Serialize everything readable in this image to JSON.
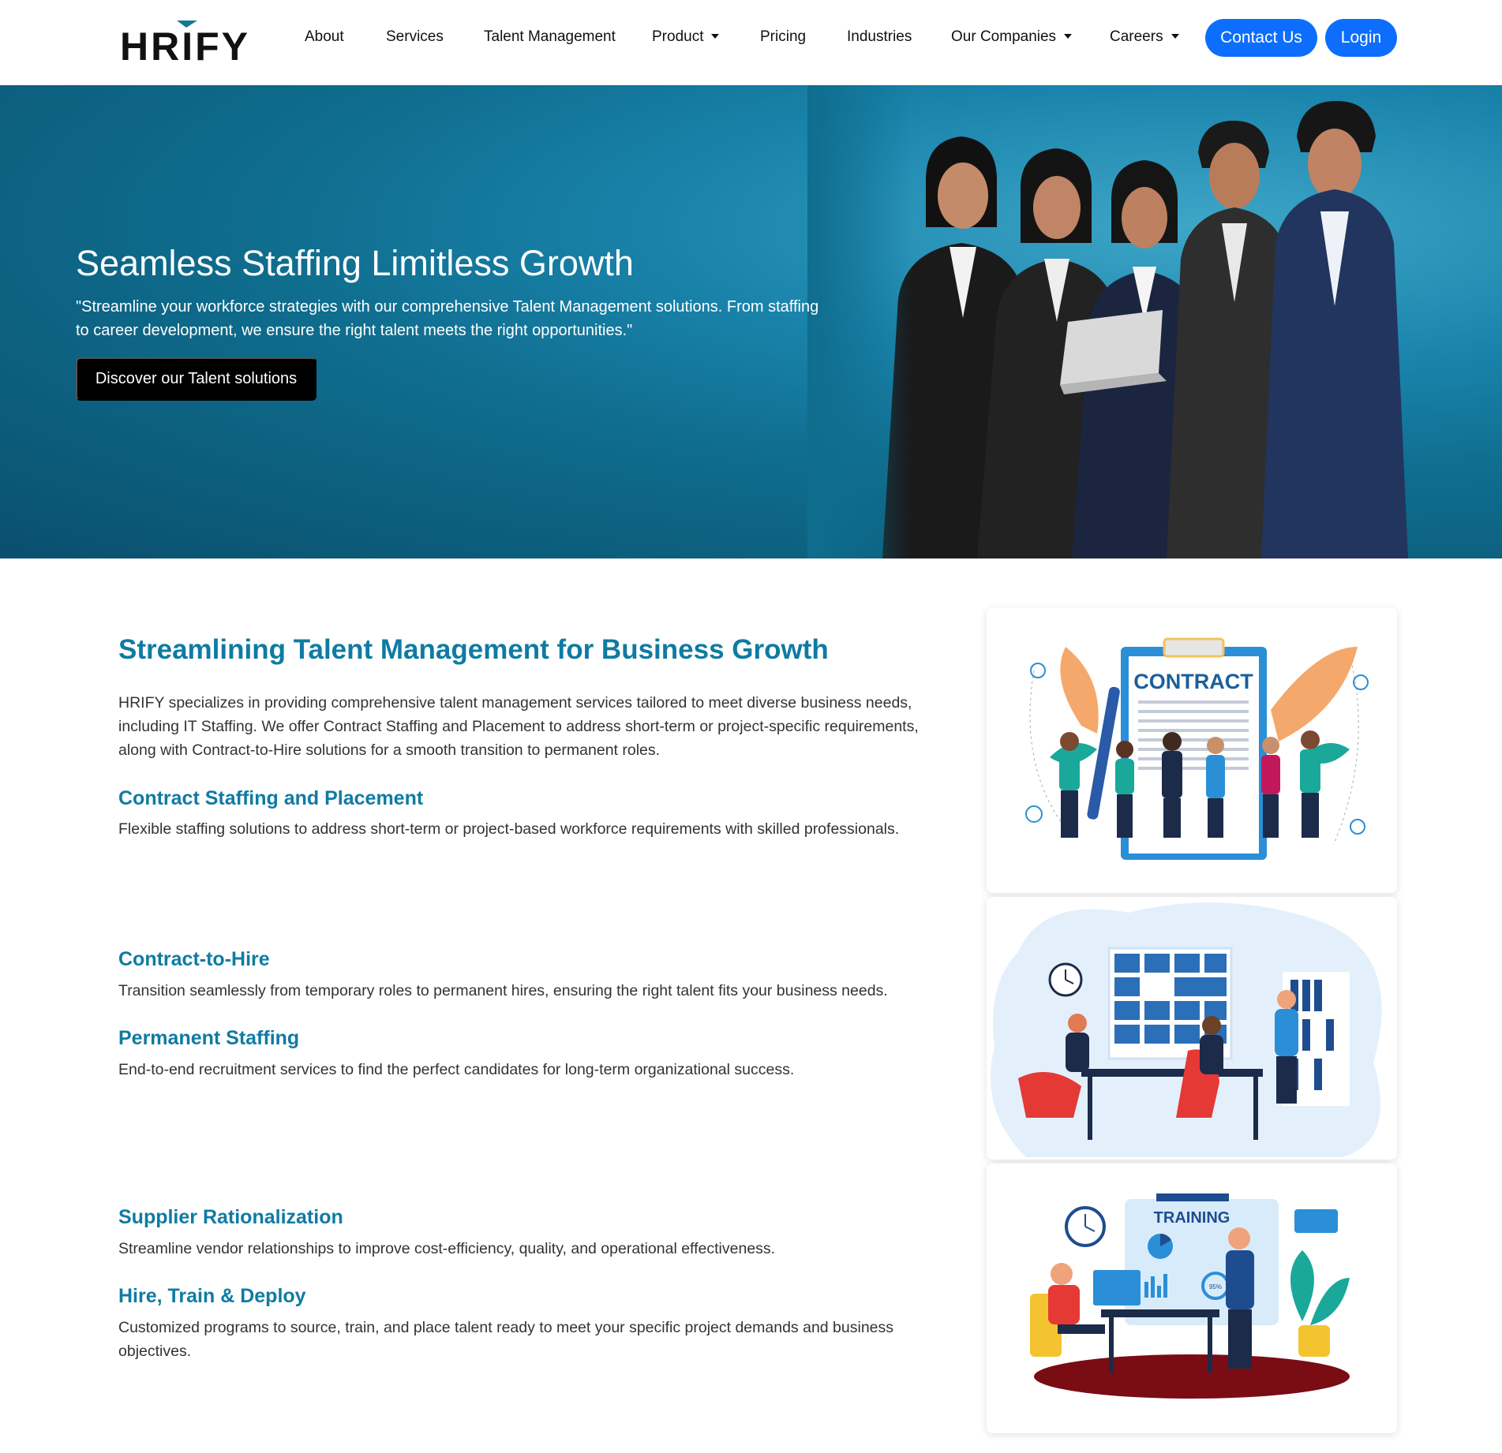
{
  "brand": {
    "logo_text": "HRIFY"
  },
  "nav": {
    "about": "About",
    "services": "Services",
    "talent_management": "Talent Management",
    "product": "Product",
    "pricing": "Pricing",
    "industries": "Industries",
    "our_companies": "Our Companies",
    "careers": "Careers",
    "contact": "Contact Us",
    "login": "Login"
  },
  "hero": {
    "title": "Seamless Staffing Limitless Growth",
    "text": "\"Streamline your workforce strategies with our comprehensive Talent Management solutions. From staffing to career development, we ensure the right talent meets the right opportunities.\"",
    "button": "Discover our Talent solutions"
  },
  "main": {
    "title": "Streamlining Talent Management for Business Growth",
    "intro": "HRIFY specializes in providing comprehensive talent management services tailored to meet diverse business needs, including IT Staffing. We offer Contract Staffing and Placement to address short-term or project-specific requirements, along with Contract-to-Hire solutions for a smooth transition to permanent roles.",
    "services": [
      {
        "title": "Contract Staffing and Placement",
        "desc": "Flexible staffing solutions to address short-term or project-based workforce requirements with skilled professionals."
      },
      {
        "title": "Contract-to-Hire",
        "desc": "Transition seamlessly from temporary roles to permanent hires, ensuring the right talent fits your business needs."
      },
      {
        "title": "Permanent Staffing",
        "desc": "End-to-end recruitment services to find the perfect candidates for long-term organizational success."
      },
      {
        "title": "Supplier Rationalization",
        "desc": "Streamline vendor relationships to improve cost-efficiency, quality, and operational effectiveness."
      },
      {
        "title": "Hire, Train & Deploy",
        "desc": "Customized programs to source, train, and place talent ready to meet your specific project demands and business objectives."
      }
    ]
  },
  "illustrations": {
    "contract_label": "CONTRACT",
    "training_label": "TRAINING",
    "training_percent": "95%"
  },
  "colors": {
    "primary": "#0d6efd",
    "heading_teal": "#0f7ba3",
    "hero_bg": "#0f6d8e"
  }
}
